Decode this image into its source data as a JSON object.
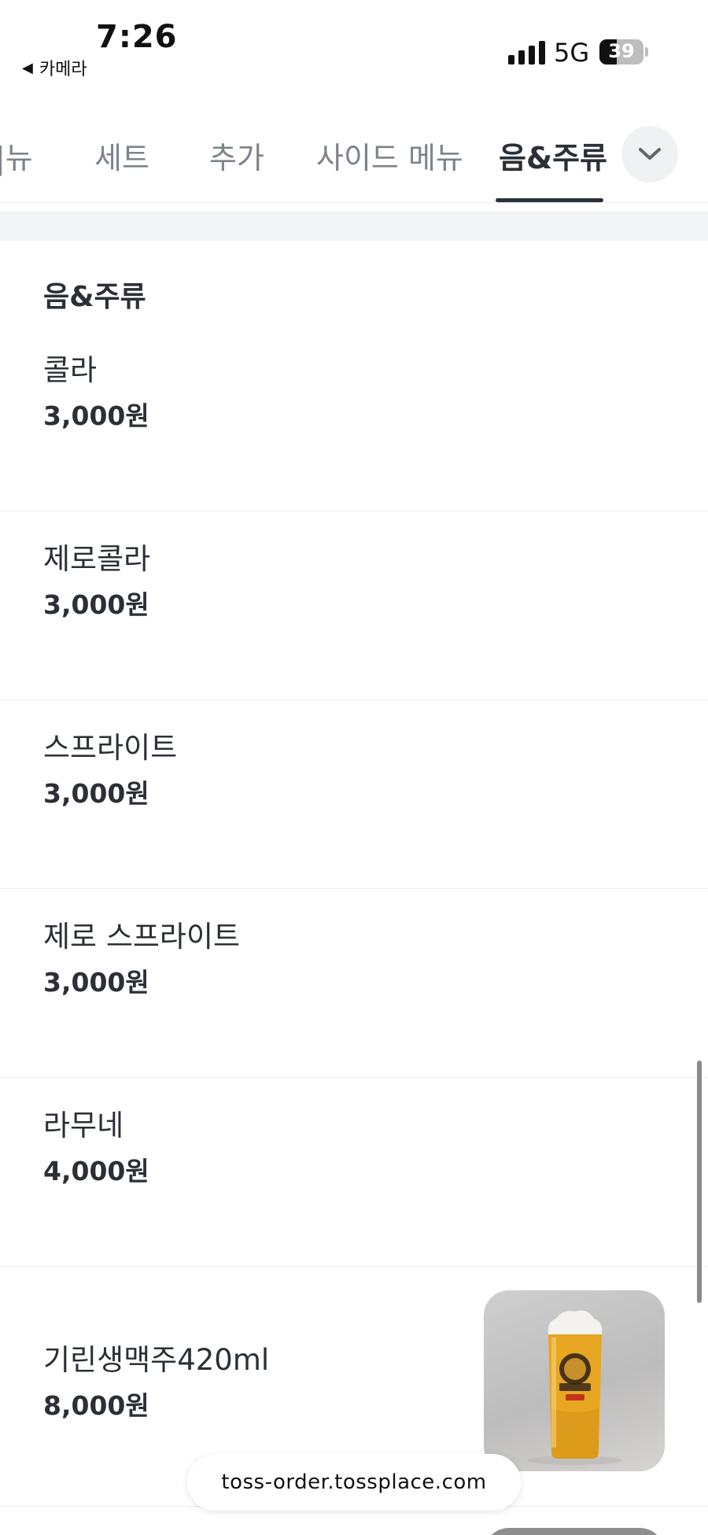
{
  "status_bar": {
    "time": "7:26",
    "back_app": "카메라",
    "network": "5G",
    "battery_percent": 39
  },
  "tabs": [
    {
      "label": "메뉴",
      "shown": "|뉴",
      "active": false
    },
    {
      "label": "세트",
      "active": false
    },
    {
      "label": "추가",
      "active": false
    },
    {
      "label": "사이드 메뉴",
      "active": false
    },
    {
      "label": "음&주류",
      "active": true
    }
  ],
  "tab_icons": {
    "more": "chevron-down-icon"
  },
  "section": {
    "title": "음&주류"
  },
  "menu": [
    {
      "name": "콜라",
      "price": "3,000원"
    },
    {
      "name": "제로콜라",
      "price": "3,000원"
    },
    {
      "name": "스프라이트",
      "price": "3,000원"
    },
    {
      "name": "제로 스프라이트",
      "price": "3,000원"
    },
    {
      "name": "라무네",
      "price": "4,000원"
    },
    {
      "name": "기린생맥주420ml",
      "price": "8,000원",
      "has_image": true
    }
  ],
  "url_bar": {
    "host": "toss-order.tossplace.com"
  },
  "colors": {
    "text": "#2b2f36",
    "muted": "#7d838c",
    "divider": "#eceef0",
    "band": "#f2f4f6"
  }
}
